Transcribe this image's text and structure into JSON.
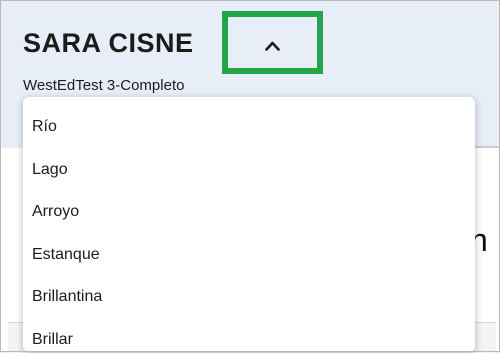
{
  "header": {
    "user_name": "SARA CISNE",
    "test_name": "WestEdTest 3-Completo"
  },
  "dropdown": {
    "items": [
      "Río",
      "Lago",
      "Arroyo",
      "Estanque",
      "Brillantina",
      "Brillar"
    ]
  },
  "main": {
    "partial_heading": "n"
  },
  "colors": {
    "highlight": "#23a64a",
    "header_background": "#e8eef7"
  },
  "icons": {
    "toggle": "chevron-up-icon"
  }
}
